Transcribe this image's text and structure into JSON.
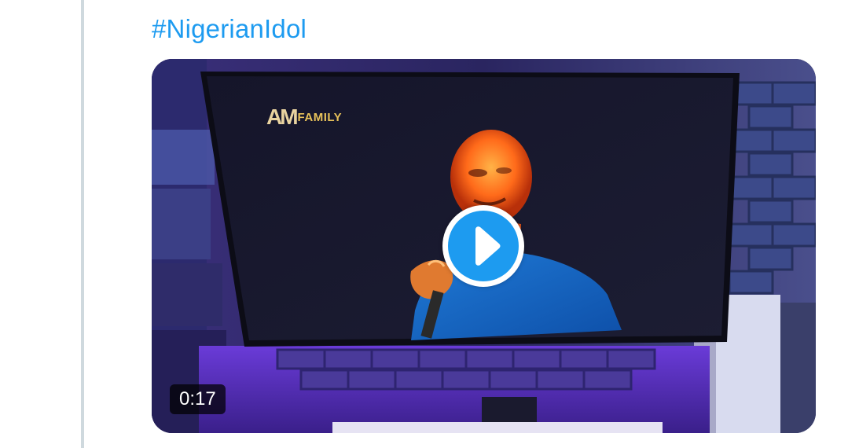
{
  "tweet": {
    "hashtag": "#NigerianIdol"
  },
  "video": {
    "channel_logo_mark": "AM",
    "channel_logo_text": "FAMILY",
    "duration": "0:17",
    "play_icon": "play-icon",
    "colors": {
      "play_button": "#1d9bf0",
      "hashtag": "#1d9bf0",
      "thread_line": "#cfd9de"
    }
  }
}
